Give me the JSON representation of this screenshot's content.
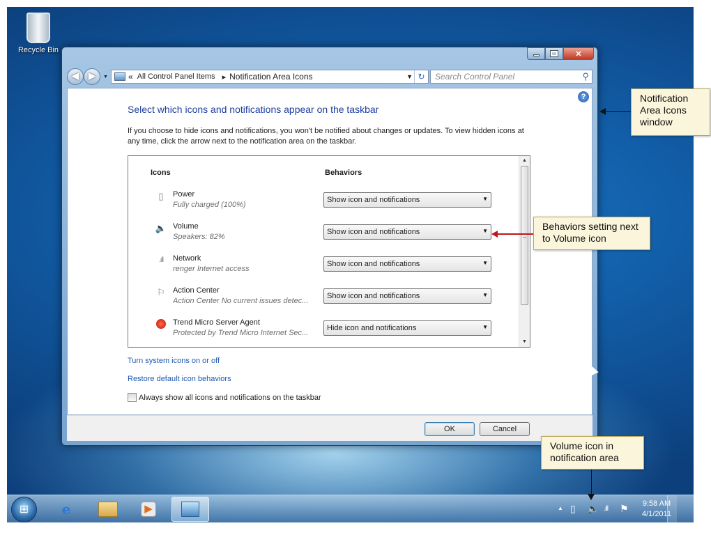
{
  "desktop": {
    "recycle_bin_label": "Recycle Bin"
  },
  "window": {
    "title": "Notification Area Icons",
    "address_parts": [
      "«",
      "All Control Panel Items",
      "▸",
      "Notification Area Icons"
    ],
    "search_placeholder": "Search Control Panel",
    "page_title": "Select which icons and notifications appear on the taskbar",
    "description": "If you choose to hide icons and notifications, you won't be notified about changes or updates. To view hidden icons at any time, click the arrow next to the notification area on the taskbar.",
    "table": {
      "columns": [
        "Icons",
        "Behaviors"
      ],
      "rows": [
        {
          "name": "Power",
          "description": "Fully charged (100%)",
          "behavior": "Show icon and notifications",
          "icon": "power-icon"
        },
        {
          "name": "Volume",
          "description": "Speakers: 82%",
          "behavior": "Show icon and notifications",
          "icon": "volume-icon"
        },
        {
          "name": "Network",
          "description": "renger Internet access",
          "behavior": "Show icon and notifications",
          "icon": "network-icon"
        },
        {
          "name": "Action Center",
          "description": "Action Center  No current issues detec...",
          "behavior": "Show icon and notifications",
          "icon": "flag-icon"
        },
        {
          "name": "Trend Micro Server Agent",
          "description": "Protected by Trend Micro Internet Sec...",
          "behavior": "Hide icon and notifications",
          "icon": "trend-micro-icon"
        }
      ]
    },
    "links": {
      "system_icons": "Turn system icons on or off",
      "restore": "Restore default icon behaviors"
    },
    "always_show_label": "Always show all icons and notifications on the taskbar",
    "always_show_checked": false,
    "buttons": {
      "ok": "OK",
      "cancel": "Cancel"
    }
  },
  "taskbar": {
    "clock_time": "9:58 AM",
    "clock_date": "4/1/2011"
  },
  "callouts": {
    "window": "Notification Area Icons window",
    "behaviors": "Behaviors setting next to Volume icon",
    "volume": "Volume icon in notification area"
  },
  "colors": {
    "link": "#1e58b0",
    "title": "#1e3ea0",
    "callout_bg": "#fbf5dc",
    "callout_arrow_red": "#c0151b"
  }
}
